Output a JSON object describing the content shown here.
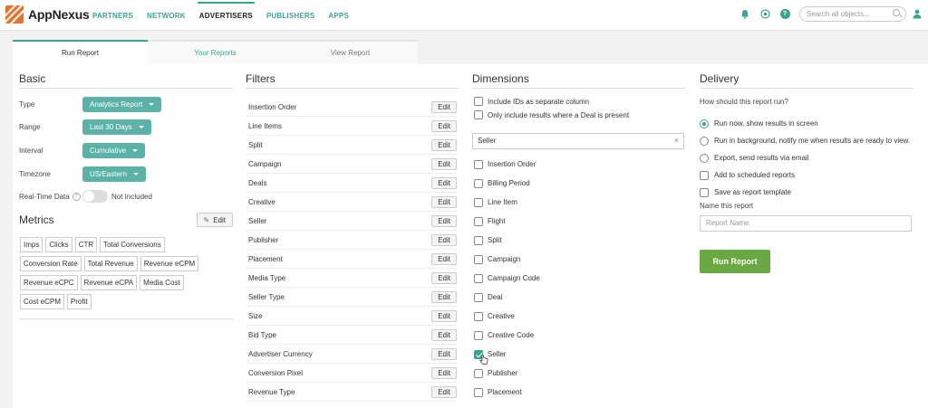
{
  "app": {
    "logo_text": "AppNexus",
    "nav": [
      "PARTNERS",
      "NETWORK",
      "ADVERTISERS",
      "PUBLISHERS",
      "APPS"
    ],
    "active_nav": "ADVERTISERS",
    "search_placeholder": "Search all objects..."
  },
  "tabs": [
    "Run Report",
    "Your Reports",
    "View Report"
  ],
  "basic": {
    "title": "Basic",
    "type_label": "Type",
    "type_value": "Analytics Report",
    "range_label": "Range",
    "range_value": "Last 30 Days",
    "interval_label": "Interval",
    "interval_value": "Cumulative",
    "timezone_label": "Timezone",
    "timezone_value": "US/Eastern",
    "realtime_label": "Real-Time Data",
    "realtime_help": "?",
    "realtime_value": "Not Included"
  },
  "metrics": {
    "title": "Metrics",
    "edit_label": "Edit",
    "chips": [
      "Imps",
      "Clicks",
      "CTR",
      "Total Conversions",
      "Conversion Rate",
      "Total Revenue",
      "Revenue eCPM",
      "Revenue eCPC",
      "Revenue eCPA",
      "Media Cost",
      "Cost eCPM",
      "Profit"
    ]
  },
  "filters": {
    "title": "Filters",
    "edit_label": "Edit",
    "items": [
      "Insertion Order",
      "Line Items",
      "Split",
      "Campaign",
      "Deals",
      "Creative",
      "Seller",
      "Publisher",
      "Placement",
      "Media Type",
      "Seller Type",
      "Size",
      "Bid Type",
      "Advertiser Currency",
      "Conversion Pixel",
      "Revenue Type"
    ]
  },
  "dimensions": {
    "title": "Dimensions",
    "include_ids": "Include IDs as separate column",
    "deal_only": "Only include results where a Deal is present",
    "search_value": "Seller",
    "clear_symbol": "×",
    "items": [
      {
        "label": "Insertion Order",
        "checked": false
      },
      {
        "label": "Billing Period",
        "checked": false
      },
      {
        "label": "Line Item",
        "checked": false
      },
      {
        "label": "Flight",
        "checked": false
      },
      {
        "label": "Split",
        "checked": false
      },
      {
        "label": "Campaign",
        "checked": false
      },
      {
        "label": "Campaign Code",
        "checked": false
      },
      {
        "label": "Deal",
        "checked": false
      },
      {
        "label": "Creative",
        "checked": false
      },
      {
        "label": "Creative Code",
        "checked": false
      },
      {
        "label": "Seller",
        "checked": true
      },
      {
        "label": "Publisher",
        "checked": false
      },
      {
        "label": "Placement",
        "checked": false
      }
    ]
  },
  "delivery": {
    "title": "Delivery",
    "question": "How should this report run?",
    "options": [
      "Run now, show results in screen",
      "Run in background, notify me when results are ready to view.",
      "Export, send results via email"
    ],
    "selected_option": 0,
    "add_scheduled": "Add to scheduled reports",
    "save_template": "Save as report template",
    "name_label": "Name this report",
    "name_placeholder": "Report Name",
    "run_button": "Run Report"
  },
  "colors": {
    "accent": "#3aa394",
    "pill": "#5ab3a6",
    "run_button": "#6aa843",
    "logo": "#e8732c"
  }
}
